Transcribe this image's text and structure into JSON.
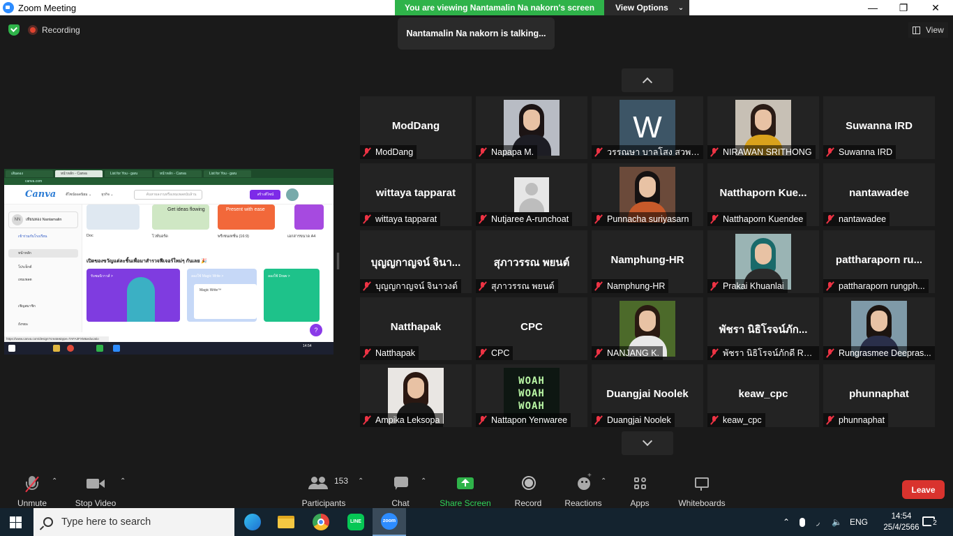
{
  "window": {
    "title": "Zoom Meeting",
    "min": "—",
    "restore": "❐",
    "close": "✕"
  },
  "share_banner": {
    "message": "You are viewing Nantamalin Na nakorn's screen",
    "options_label": "View Options",
    "options_caret": "⌄"
  },
  "recording_label": "Recording",
  "talking_label": "Nantamalin Na nakorn is talking...",
  "view_label": "View",
  "shared_screen": {
    "tabs": [
      "เดิมดอง",
      "หน้าหลัก - Canva",
      "List for You - garu",
      "หน้าหลัก - Canva",
      "List for You - garu"
    ],
    "url": "canva.com",
    "logo": "Canva",
    "nav1": "ดีไซน์ยอดนิยม ⌄",
    "nav2": "ธุรกิจ ⌄",
    "search_placeholder": "ค้นหาผลงานหรือเทมเพลตนับล้าน",
    "create_btn": "สร้างดีไซน์",
    "profile_initials": "NN",
    "profile_name": "เทียนทอง Nantamalin",
    "side_join": "เข้าร่วมกับโรงเรียน",
    "side_items": [
      "หน้าหลัก",
      "โปรเจ็กต์",
      "เทมเพลต",
      "เชิญสมาชิก",
      "ถังขยะ"
    ],
    "card_labels": [
      "Doc",
      "ไวท์บอร์ด",
      "พรีเซนเทชั่น (16:9)",
      "เอกสารขนาด A4"
    ],
    "card_texts": [
      "Get ideas flowing",
      "Present with ease"
    ],
    "heading": "เปิดของขวัญแต่ละชิ้นเพื่อมาสำรวจฟีเจอร์ใหม่ๆ กันเลย 🎉",
    "big_cards": [
      "รับชมนิวาวส์ >",
      "ลองใช้ Magic Write >",
      "ลองใช้ Draw >"
    ],
    "magic_write": "Magic Write™",
    "help": "?",
    "status_url": "https://www.canva.com/design?create&type=TAFA3FXM&educatio",
    "clock": "14:54"
  },
  "participants": [
    {
      "display": "ModDang",
      "name": "ModDang",
      "kind": "text"
    },
    {
      "display": "",
      "name": "Napapa M.",
      "kind": "photo",
      "photo": {
        "bg": "#b8bcc4",
        "hair": "#1c1414",
        "body": "#1d1d24"
      }
    },
    {
      "display": "W",
      "name": "วรรณษา บาลโสง สวพ.ม...",
      "kind": "letter"
    },
    {
      "display": "",
      "name": "NIRAWAN SRITHONG",
      "kind": "photo",
      "photo": {
        "bg": "#c7c0b5",
        "hair": "#2a1c16",
        "body": "#d9a21c"
      }
    },
    {
      "display": "Suwanna IRD",
      "name": "Suwanna IRD",
      "kind": "text"
    },
    {
      "display": "wittaya tapparat",
      "name": "wittaya tapparat",
      "kind": "text"
    },
    {
      "display": "",
      "name": "Nutjaree A-runchoat",
      "kind": "default"
    },
    {
      "display": "",
      "name": "Punnacha suriyasarn",
      "kind": "photo",
      "photo": {
        "bg": "#6b4a3a",
        "hair": "#161212",
        "body": "#c75a2a"
      }
    },
    {
      "display": "Natthaporn  Kue...",
      "name": "Natthaporn Kuendee",
      "kind": "text"
    },
    {
      "display": "nantawadee",
      "name": "nantawadee",
      "kind": "text"
    },
    {
      "display": "บุญญกาญจน์ จินา...",
      "name": "บุญญกาญจน์ จินาวงต์",
      "kind": "text"
    },
    {
      "display": "สุภาวรรณ พยนต์",
      "name": "สุภาวรรณ พยนต์",
      "kind": "text"
    },
    {
      "display": "Namphung-HR",
      "name": "Namphung-HR",
      "kind": "text"
    },
    {
      "display": "",
      "name": "Prakai Khuanlai",
      "kind": "photo",
      "photo": {
        "bg": "#9ab4b4",
        "hair": "#1a6a6a",
        "body": "#2b2b2b"
      }
    },
    {
      "display": "pattharaporn  ru...",
      "name": "pattharaporn rungph...",
      "kind": "text"
    },
    {
      "display": "Natthapak",
      "name": "Natthapak",
      "kind": "text"
    },
    {
      "display": "CPC",
      "name": "CPC",
      "kind": "text"
    },
    {
      "display": "",
      "name": "NANJANG K.",
      "kind": "photo",
      "photo": {
        "bg": "#4c6a2a",
        "hair": "#2a1a12",
        "body": "#e8e8e8"
      }
    },
    {
      "display": "พัชรา นิธิโรจน์ภัก...",
      "name": "พัชรา นิธิโรจน์ภักดี RM...",
      "kind": "text"
    },
    {
      "display": "",
      "name": "Rungrasmee Deepras...",
      "kind": "photo",
      "photo": {
        "bg": "#7f9aa8",
        "hair": "#1c1410",
        "body": "#2a2f4a"
      }
    },
    {
      "display": "",
      "name": "Ampika Leksopa",
      "kind": "photo",
      "photo": {
        "bg": "#e9e6e3",
        "hair": "#2a1812",
        "body": "#1a1a1a"
      }
    },
    {
      "display": "WOAH\nWOAH\nWOAH",
      "name": "Nattapon Yenwaree",
      "kind": "woah"
    },
    {
      "display": "Duangjai Noolek",
      "name": "Duangjai Noolek",
      "kind": "text"
    },
    {
      "display": "keaw_cpc",
      "name": "keaw_cpc",
      "kind": "text"
    },
    {
      "display": "phunnaphat",
      "name": "phunnaphat",
      "kind": "text"
    }
  ],
  "toolbar": {
    "unmute": "Unmute",
    "stop_video": "Stop Video",
    "participants": "Participants",
    "participants_count": "153",
    "chat": "Chat",
    "share_screen": "Share Screen",
    "record": "Record",
    "reactions": "Reactions",
    "apps": "Apps",
    "whiteboards": "Whiteboards",
    "leave": "Leave"
  },
  "taskbar": {
    "search_placeholder": "Type here to search",
    "language": "ENG",
    "time": "14:54",
    "date": "25/4/2566",
    "notifications": "2"
  },
  "colors": {
    "share_green": "#2fb34a",
    "leave_red": "#d9332e",
    "muted_red": "#e33344",
    "zoom_blue": "#2d8cff"
  }
}
